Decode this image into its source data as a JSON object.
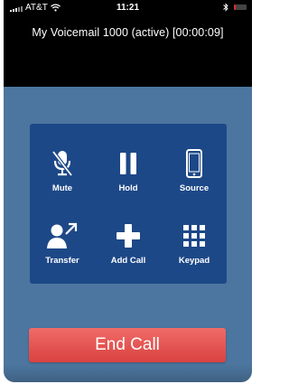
{
  "status_bar": {
    "carrier": "AT&T",
    "time": "11:21",
    "wifi_icon": "wifi-icon",
    "bluetooth_icon": "bluetooth-icon",
    "battery_level": 0.15,
    "battery_color": "#e12b2b"
  },
  "call": {
    "title": "My Voicemail  1000 (active) [00:00:09]"
  },
  "controls": [
    {
      "label": "Mute",
      "icon": "mute-microphone-icon"
    },
    {
      "label": "Hold",
      "icon": "pause-icon"
    },
    {
      "label": "Source",
      "icon": "phone-device-icon"
    },
    {
      "label": "Transfer",
      "icon": "transfer-person-icon"
    },
    {
      "label": "Add Call",
      "icon": "plus-icon"
    },
    {
      "label": "Keypad",
      "icon": "keypad-icon"
    }
  ],
  "end_call": {
    "label": "End Call",
    "color": "#e2504d"
  },
  "colors": {
    "background": "#4c769f",
    "panel": "#1d4887",
    "header": "#000000"
  }
}
